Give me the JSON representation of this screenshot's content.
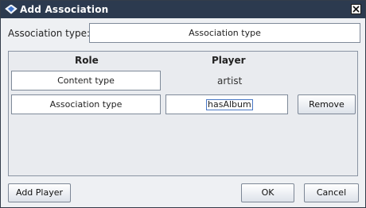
{
  "window": {
    "title": "Add Association",
    "icon": "topic-map-diamond-icon",
    "close_icon": "close-x-icon"
  },
  "association_type": {
    "label": "Association type:",
    "value": "Association type"
  },
  "table": {
    "role_header": "Role",
    "player_header": "Player",
    "rows": [
      {
        "role": "Content type",
        "player": "artist"
      },
      {
        "role": "Association type",
        "player": "hasAlbum",
        "action": "Remove"
      }
    ]
  },
  "footer": {
    "add_player": "Add Player",
    "ok": "OK",
    "cancel": "Cancel"
  }
}
